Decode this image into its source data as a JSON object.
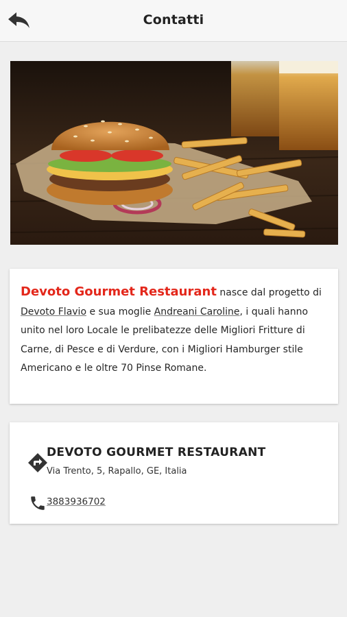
{
  "header": {
    "title": "Contatti",
    "back_icon": "back-arrow-icon"
  },
  "hero": {
    "description": "burger-and-fries-photo"
  },
  "about": {
    "brand": "Devoto Gourmet Restaurant",
    "text_1": " nasce dal progetto di ",
    "link_1": "Devoto Flavio",
    "text_2": " e sua moglie ",
    "link_2": "Andreani Caroline",
    "text_3": ", i quali hanno unito nel loro Locale le prelibatezze delle Migliori Fritture di Carne, di Pesce e di Verdure, con i Migliori Hamburger stile Americano e le oltre 70 Pinse Romane.",
    "brand_color": "#e3271b"
  },
  "contact": {
    "name": "DEVOTO GOURMET RESTAURANT",
    "address": "Via Trento, 5, Rapallo, GE, Italia",
    "phone": "3883936702",
    "address_icon": "directions-icon",
    "phone_icon": "phone-icon"
  }
}
